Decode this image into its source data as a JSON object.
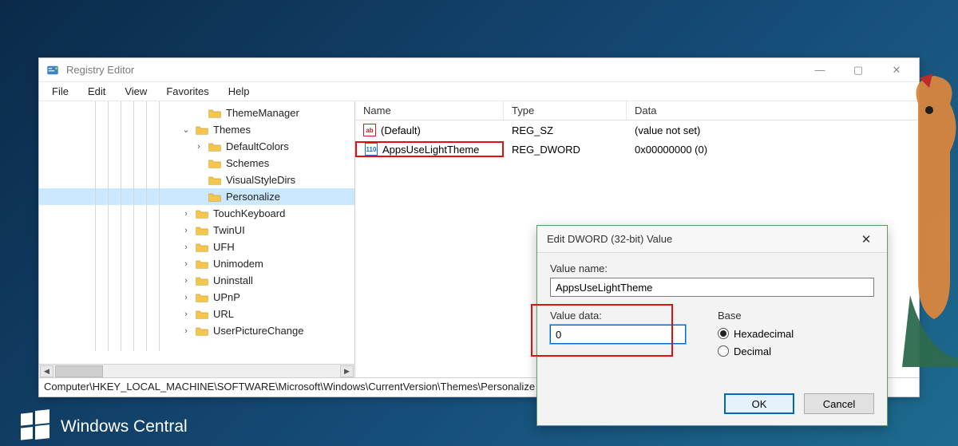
{
  "window": {
    "title": "Registry Editor",
    "menu": {
      "file": "File",
      "edit": "Edit",
      "view": "View",
      "favorites": "Favorites",
      "help": "Help"
    },
    "status_path": "Computer\\HKEY_LOCAL_MACHINE\\SOFTWARE\\Microsoft\\Windows\\CurrentVersion\\Themes\\Personalize"
  },
  "tree": {
    "items": [
      {
        "depth": 8,
        "exp": "none",
        "label": "ThemeManager"
      },
      {
        "depth": 7,
        "exp": "open",
        "label": "Themes"
      },
      {
        "depth": 8,
        "exp": "closed",
        "label": "DefaultColors"
      },
      {
        "depth": 8,
        "exp": "none",
        "label": "Schemes"
      },
      {
        "depth": 8,
        "exp": "none",
        "label": "VisualStyleDirs"
      },
      {
        "depth": 8,
        "exp": "none",
        "label": "Personalize",
        "selected": true
      },
      {
        "depth": 7,
        "exp": "closed",
        "label": "TouchKeyboard"
      },
      {
        "depth": 7,
        "exp": "closed",
        "label": "TwinUI"
      },
      {
        "depth": 7,
        "exp": "closed",
        "label": "UFH"
      },
      {
        "depth": 7,
        "exp": "closed",
        "label": "Unimodem"
      },
      {
        "depth": 7,
        "exp": "closed",
        "label": "Uninstall"
      },
      {
        "depth": 7,
        "exp": "closed",
        "label": "UPnP"
      },
      {
        "depth": 7,
        "exp": "closed",
        "label": "URL"
      },
      {
        "depth": 7,
        "exp": "closed",
        "label": "UserPictureChange"
      }
    ]
  },
  "list": {
    "headers": {
      "name": "Name",
      "type": "Type",
      "data": "Data"
    },
    "rows": [
      {
        "icon": "str",
        "name": "(Default)",
        "type": "REG_SZ",
        "data": "(value not set)"
      },
      {
        "icon": "dword",
        "name": "AppsUseLightTheme",
        "type": "REG_DWORD",
        "data": "0x00000000 (0)",
        "highlight": true
      }
    ]
  },
  "dialog": {
    "title": "Edit DWORD (32-bit) Value",
    "name_label": "Value name:",
    "name_value": "AppsUseLightTheme",
    "data_label": "Value data:",
    "data_value": "0",
    "base_label": "Base",
    "hex_label": "Hexadecimal",
    "dec_label": "Decimal",
    "ok": "OK",
    "cancel": "Cancel"
  },
  "brand": {
    "text": "Windows Central"
  },
  "icons": {
    "expander_closed": "›",
    "expander_open": "⌄",
    "str_glyph": "ab",
    "dword_glyph": "110",
    "close_glyph": "✕",
    "min_glyph": "—",
    "max_glyph": "▢",
    "scroll_left": "◀",
    "scroll_right": "▶"
  }
}
